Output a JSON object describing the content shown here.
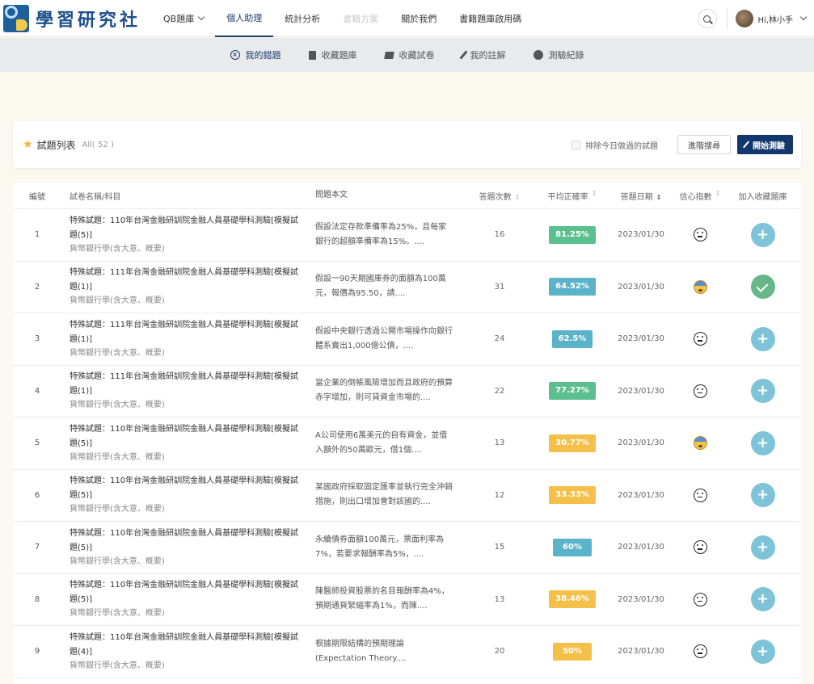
{
  "logo": {
    "text": "學習研究社"
  },
  "nav": {
    "items": [
      {
        "label": "QB題庫",
        "dropdown": true,
        "state": "normal"
      },
      {
        "label": "個人助理",
        "state": "active"
      },
      {
        "label": "統計分析",
        "state": "normal"
      },
      {
        "label": "書籍方案",
        "state": "disabled"
      },
      {
        "label": "關於我們",
        "state": "normal"
      },
      {
        "label": "書籍題庫啟用碼",
        "state": "normal"
      }
    ],
    "user_greeting": "Hi,林小手"
  },
  "subnav": {
    "items": [
      {
        "label": "我的錯題",
        "icon": "x-circle-icon",
        "active": true
      },
      {
        "label": "收藏題庫",
        "icon": "book-icon",
        "active": false
      },
      {
        "label": "收藏試卷",
        "icon": "paper-icon",
        "active": false
      },
      {
        "label": "我的註解",
        "icon": "pen-icon",
        "active": false
      },
      {
        "label": "測驗紀錄",
        "icon": "clock-icon",
        "active": false
      }
    ]
  },
  "card": {
    "title": "試題列表",
    "count": "All( 52 )",
    "exclude_label": "排除今日做過的試題",
    "advanced_search": "進階搜尋",
    "start_test": "開始測驗"
  },
  "table": {
    "headers": {
      "no": "編號",
      "name": "試卷名稱/科目",
      "question": "問題本文",
      "times": "答題次數",
      "rate": "平均正確率",
      "date": "答題日期",
      "confidence": "信心指數",
      "add": "加入收藏題庫"
    },
    "rows": [
      {
        "no": "1",
        "name": "特殊試題：110年台灣金融研訓院金融人員基礎學科測驗[模擬試題(5)]",
        "subject": "貨幣銀行學(含大意、概要)",
        "question": "假設法定存款準備率為25%，且每家銀行的超額準備率為15%。....",
        "times": "16",
        "rate": "81.25%",
        "rate_color": "#5cbf8f",
        "date": "2023/01/30",
        "confidence": "neutral",
        "collected": false
      },
      {
        "no": "2",
        "name": "特殊試題：111年台灣金融研訓院金融人員基礎學科測驗[模擬試題(1)]",
        "subject": "貨幣銀行學(含大意、概要)",
        "question": "假設一90天期國庫券的面額為100萬元，報價為95.50，請....",
        "times": "31",
        "rate": "64.52%",
        "rate_color": "#5bb3c9",
        "date": "2023/01/30",
        "confidence": "worried",
        "collected": true
      },
      {
        "no": "3",
        "name": "特殊試題：111年台灣金融研訓院金融人員基礎學科測驗[模擬試題(1)]",
        "subject": "貨幣銀行學(含大意、概要)",
        "question": "假設中央銀行透過公開市場操作向銀行體系賣出1,000億公債，....",
        "times": "24",
        "rate": "62.5%",
        "rate_color": "#5bb3c9",
        "date": "2023/01/30",
        "confidence": "neutral",
        "collected": false
      },
      {
        "no": "4",
        "name": "特殊試題：111年台灣金融研訓院金融人員基礎學科測驗[模擬試題(1)]",
        "subject": "貨幣銀行學(含大意、概要)",
        "question": "當企業的倒帳風險增加而且政府的預算赤字增加，則可貸資金市場的....",
        "times": "22",
        "rate": "77.27%",
        "rate_color": "#5cbf8f",
        "date": "2023/01/30",
        "confidence": "neutral",
        "collected": false
      },
      {
        "no": "5",
        "name": "特殊試題：110年台灣金融研訓院金融人員基礎學科測驗[模擬試題(5)]",
        "subject": "貨幣銀行學(含大意、概要)",
        "question": "A公司使用6萬美元的自有資金，並借入額外的50萬歐元，借1個....",
        "times": "13",
        "rate": "30.77%",
        "rate_color": "#f5c04a",
        "date": "2023/01/30",
        "confidence": "worried",
        "collected": false
      },
      {
        "no": "6",
        "name": "特殊試題：110年台灣金融研訓院金融人員基礎學科測驗[模擬試題(5)]",
        "subject": "貨幣銀行學(含大意、概要)",
        "question": "某國政府採取固定匯率並執行完全沖銷措施，則出口增加會對該國的....",
        "times": "12",
        "rate": "33.33%",
        "rate_color": "#f5c04a",
        "date": "2023/01/30",
        "confidence": "neutral",
        "collected": false
      },
      {
        "no": "7",
        "name": "特殊試題：110年台灣金融研訓院金融人員基礎學科測驗[模擬試題(5)]",
        "subject": "貨幣銀行學(含大意、概要)",
        "question": "永續債券面額100萬元，票面利率為7%，若要求報酬率為5%，....",
        "times": "15",
        "rate": "60%",
        "rate_color": "#5bb3c9",
        "date": "2023/01/30",
        "confidence": "neutral",
        "collected": false
      },
      {
        "no": "8",
        "name": "特殊試題：110年台灣金融研訓院金融人員基礎學科測驗[模擬試題(5)]",
        "subject": "貨幣銀行學(含大意、概要)",
        "question": "陳醫師投資股票的名目報酬率為4%，預期通貨緊縮率為1%，而陳....",
        "times": "13",
        "rate": "38.46%",
        "rate_color": "#f5c04a",
        "date": "2023/01/30",
        "confidence": "neutral",
        "collected": false
      },
      {
        "no": "9",
        "name": "特殊試題：110年台灣金融研訓院金融人員基礎學科測驗[模擬試題(4)]",
        "subject": "貨幣銀行學(含大意、概要)",
        "question": "根據期限結構的預期理論(Expectation Theory....",
        "times": "20",
        "rate": "50%",
        "rate_color": "#f5c04a",
        "date": "2023/01/30",
        "confidence": "neutral",
        "collected": false
      }
    ]
  }
}
